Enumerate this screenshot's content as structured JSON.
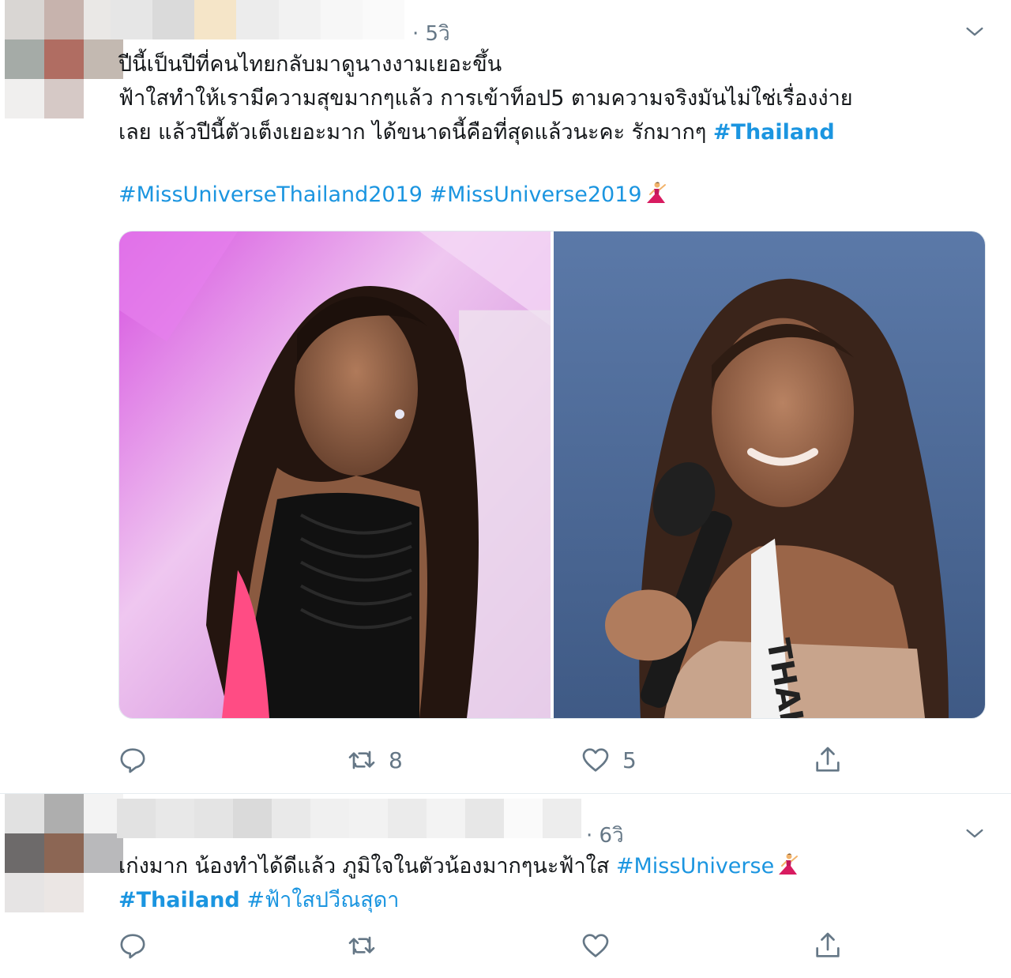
{
  "tweets": [
    {
      "time": "· 5วิ",
      "lines": [
        "ปีนี้เป็นปีที่คนไทยกลับมาดูนางงามเยอะขึ้น",
        "ฟ้าใสทำให้เรามีความสุขมากๆแล้ว การเข้าท็อป5 ตามความจริงมันไม่ใช่เรื่องง่าย",
        "เลย แล้วปีนี้ตัวเต็งเยอะมาก ได้ขนาดนี้คือที่สุดแล้วนะคะ รักมากๆ "
      ],
      "hashtag_inline": "#Thailand",
      "hashtags_line": [
        "#MissUniverseThailand2019",
        "#MissUniverse2019"
      ],
      "media": [
        {
          "description": "Contestant in black beaded gown with pink accents, looking over shoulder"
        },
        {
          "description": "Contestant with microphone wearing THAILAND sash"
        }
      ],
      "sash_text": "THAIL",
      "actions": {
        "reply_count": "",
        "retweet_count": "8",
        "like_count": "5"
      }
    },
    {
      "time": "· 6วิ",
      "line1": "เก่งมาก น้องทำได้ดีแล้ว ภูมิใจในตัวน้องมากๆนะฟ้าใส ",
      "tag1": "#MissUniverse",
      "tag2": "#Thailand",
      "tag3": "#ฟ้าใสปวีณสุดา",
      "actions": {
        "reply_count": "",
        "retweet_count": "",
        "like_count": ""
      }
    }
  ],
  "icons": {
    "reply": "reply-icon",
    "retweet": "retweet-icon",
    "like": "heart-icon",
    "share": "share-icon",
    "menu": "chevron-down-icon",
    "emoji": "dancer-emoji-icon"
  },
  "colors": {
    "hashtag": "#1b95e0",
    "secondary": "#657786",
    "text": "#14171a"
  }
}
